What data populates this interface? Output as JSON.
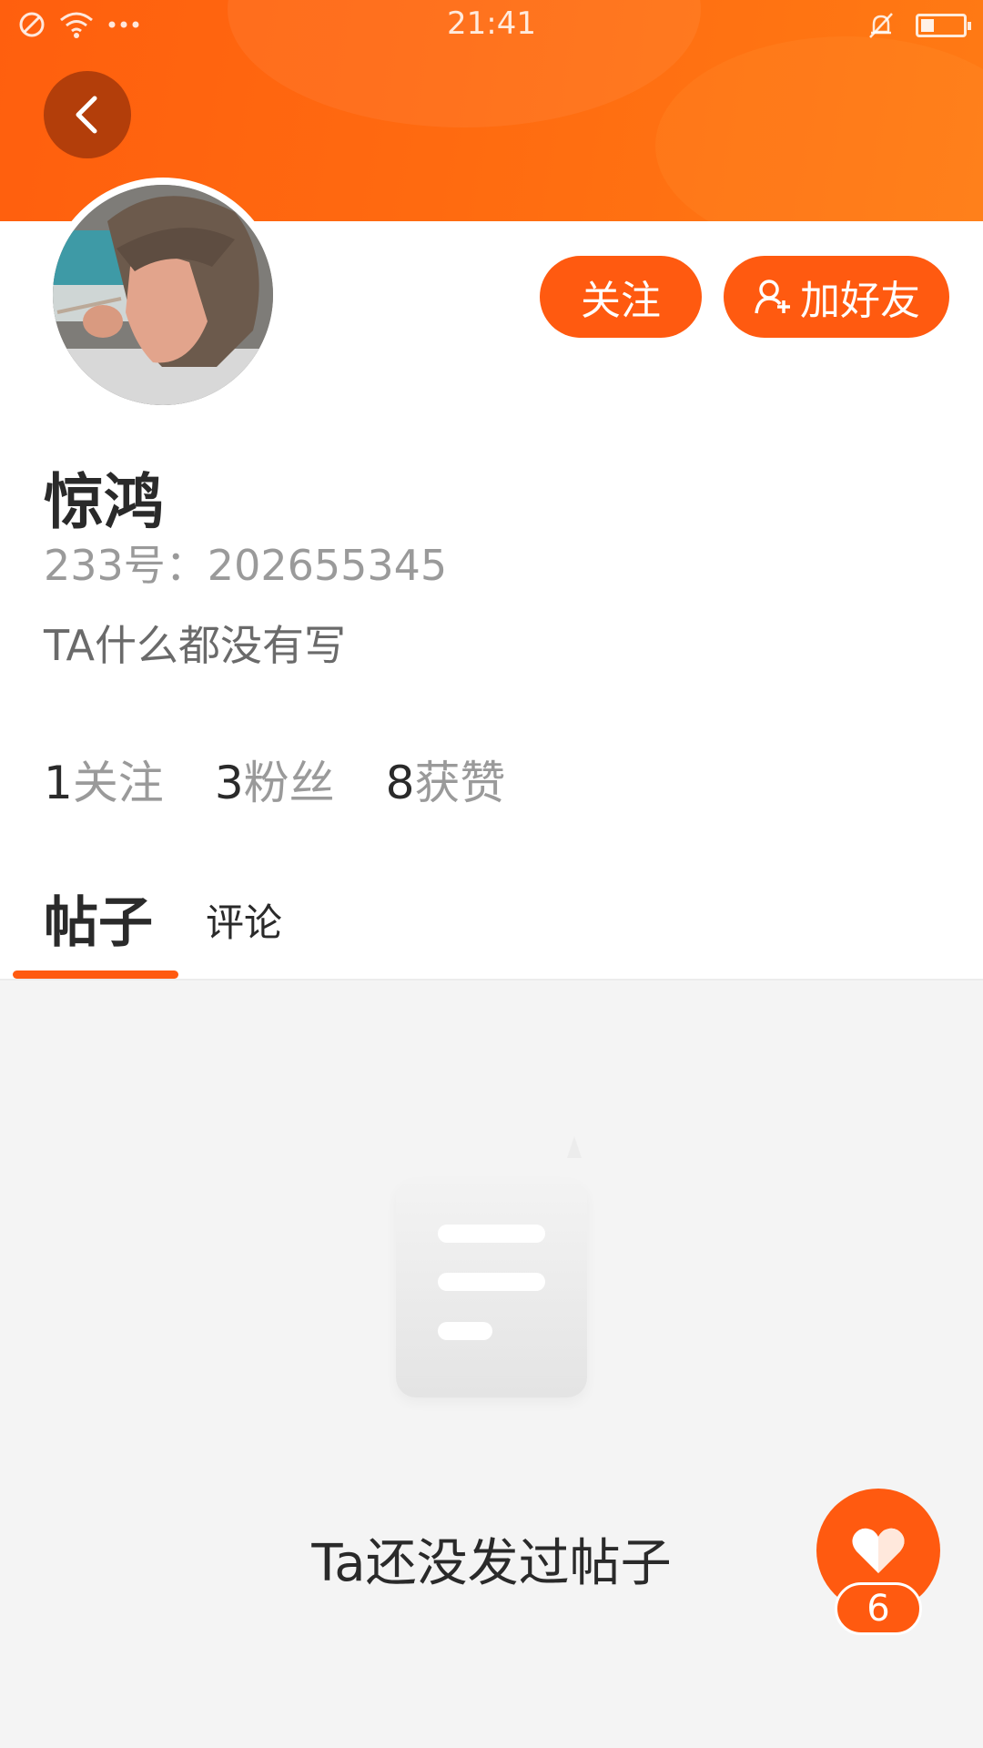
{
  "status_bar": {
    "time": "21:41"
  },
  "profile": {
    "username": "惊鸿",
    "user_id": "233号：202655345",
    "bio": "TA什么都没有写"
  },
  "actions": {
    "follow": "关注",
    "add_friend": "加好友"
  },
  "stats": [
    {
      "num": "1",
      "label": "关注"
    },
    {
      "num": "3",
      "label": "粉丝"
    },
    {
      "num": "8",
      "label": "获赞"
    }
  ],
  "tabs": {
    "posts": "帖子",
    "comments": "评论"
  },
  "empty_state": {
    "text": "Ta还没发过帖子"
  },
  "like": {
    "count": "6"
  },
  "colors": {
    "accent": "#ff5a10",
    "header": "#ff6a10",
    "back_button": "#b33e0a"
  }
}
